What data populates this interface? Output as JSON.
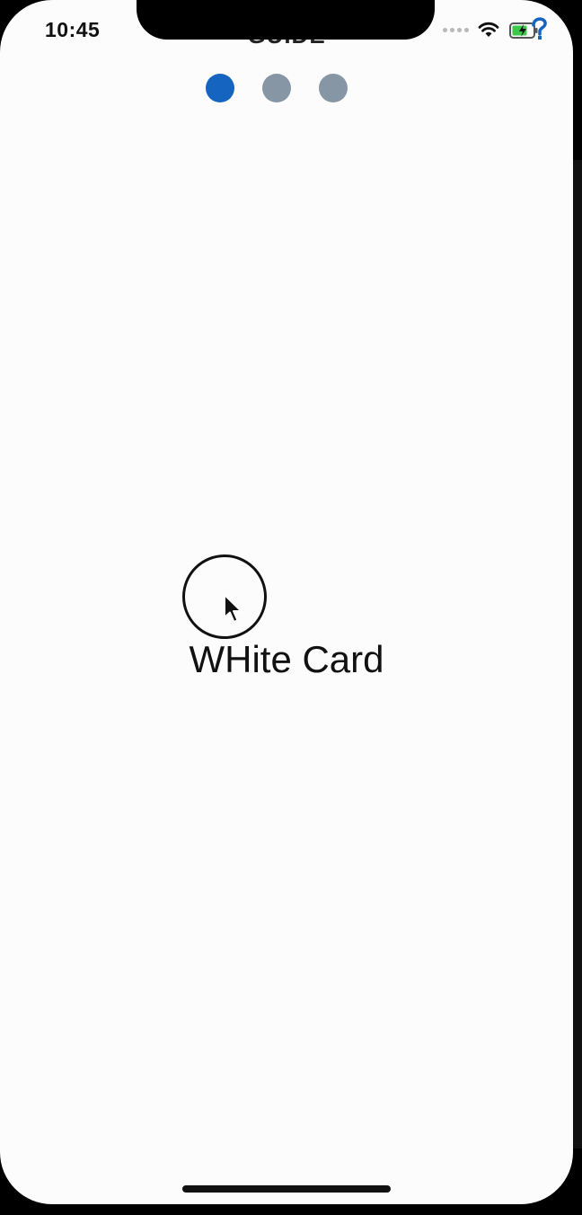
{
  "status_bar": {
    "time": "10:45",
    "icons": [
      "signal-dots-icon",
      "wifi-icon",
      "battery-charging-icon"
    ]
  },
  "header": {
    "title": "GUIDE"
  },
  "pager": {
    "active_index": 0,
    "dots": [
      {
        "state": "active"
      },
      {
        "state": "inactive"
      },
      {
        "state": "inactive"
      }
    ],
    "active_color": "#1565c0",
    "inactive_color": "#8796a5"
  },
  "card": {
    "label": "WHite Card"
  },
  "overlay": {
    "icons": [
      "tap-indicator-icon",
      "mouse-pointer-icon"
    ]
  },
  "colors": {
    "background": "#fcfcfc",
    "text": "#111111",
    "battery": "#3cc84b"
  }
}
